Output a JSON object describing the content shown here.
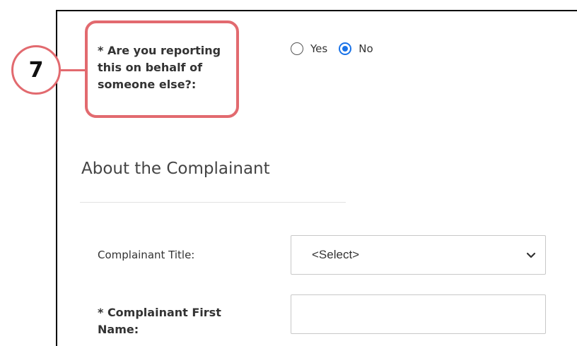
{
  "callout": {
    "step_number": "7",
    "color": "#e26a6f"
  },
  "question": {
    "label": "* Are you reporting this on behalf of someone else?:",
    "options": [
      {
        "label": "Yes",
        "checked": false
      },
      {
        "label": "No",
        "checked": true
      }
    ],
    "accent_color": "#1a73e8"
  },
  "section": {
    "title": "About the Complainant"
  },
  "fields": {
    "title": {
      "label": "Complainant Title:",
      "selected_value": "<Select>",
      "icon": "chevron-down-icon"
    },
    "first_name": {
      "label": "* Complainant First Name:",
      "value": "",
      "placeholder": ""
    }
  }
}
